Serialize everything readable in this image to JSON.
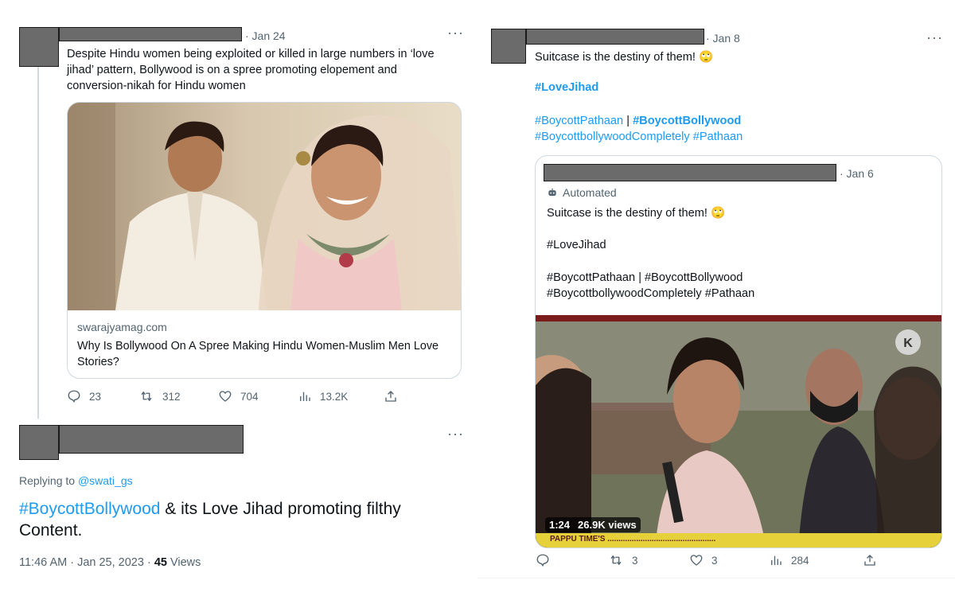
{
  "left_top_tweet": {
    "date": "· Jan 24",
    "text": "Despite Hindu women being exploited or killed in large numbers in ‘love jihad’ pattern, Bollywood is on a spree promoting elopement and conversion-nikah for Hindu women",
    "card": {
      "domain": "swarajyamag.com",
      "title": "Why Is Bollywood On A Spree Making Hindu Women-Muslim Men Love Stories?"
    },
    "actions": {
      "replies": "23",
      "retweets": "312",
      "likes": "704",
      "views": "13.2K"
    }
  },
  "left_bottom_tweet": {
    "replying_prefix": "Replying to ",
    "replying_handle": "@swati_gs",
    "hashtag": "#BoycottBollywood",
    "text_rest": " & its Love Jihad promoting filthy Content.",
    "time": "11:46 AM · Jan 25, 2023 · ",
    "views_count": "45",
    "views_label": " Views"
  },
  "right_tweet": {
    "date": "· Jan 8",
    "text": "Suitcase is the destiny of them! 🙄",
    "hashtag_love_jihad": "#LoveJihad",
    "hashtag_pathaan": "#BoycottPathaan",
    "separator": " | ",
    "hashtag_bollywood": "#BoycottBollywood",
    "hashtag_completely": "#BoycottbollywoodCompletely",
    "hashtag_pathaan2": " #Pathaan",
    "actions": {
      "retweets": "3",
      "likes": "3",
      "views": "284"
    }
  },
  "quoted_tweet": {
    "date": "· Jan 6",
    "automated": "Automated",
    "text": "Suitcase is the destiny of them! 🙄",
    "line2": "#LoveJihad",
    "line3": "#BoycottPathaan | #BoycottBollywood",
    "line4": "#BoycottbollywoodCompletely #Pathaan",
    "video_time": "1:24",
    "video_views": "26.9K views",
    "ticker_text": "PAPPU TIME'S ................................................."
  },
  "colors": {
    "accent": "#1d9bf0",
    "muted": "#536471",
    "border": "#cfd9de"
  }
}
